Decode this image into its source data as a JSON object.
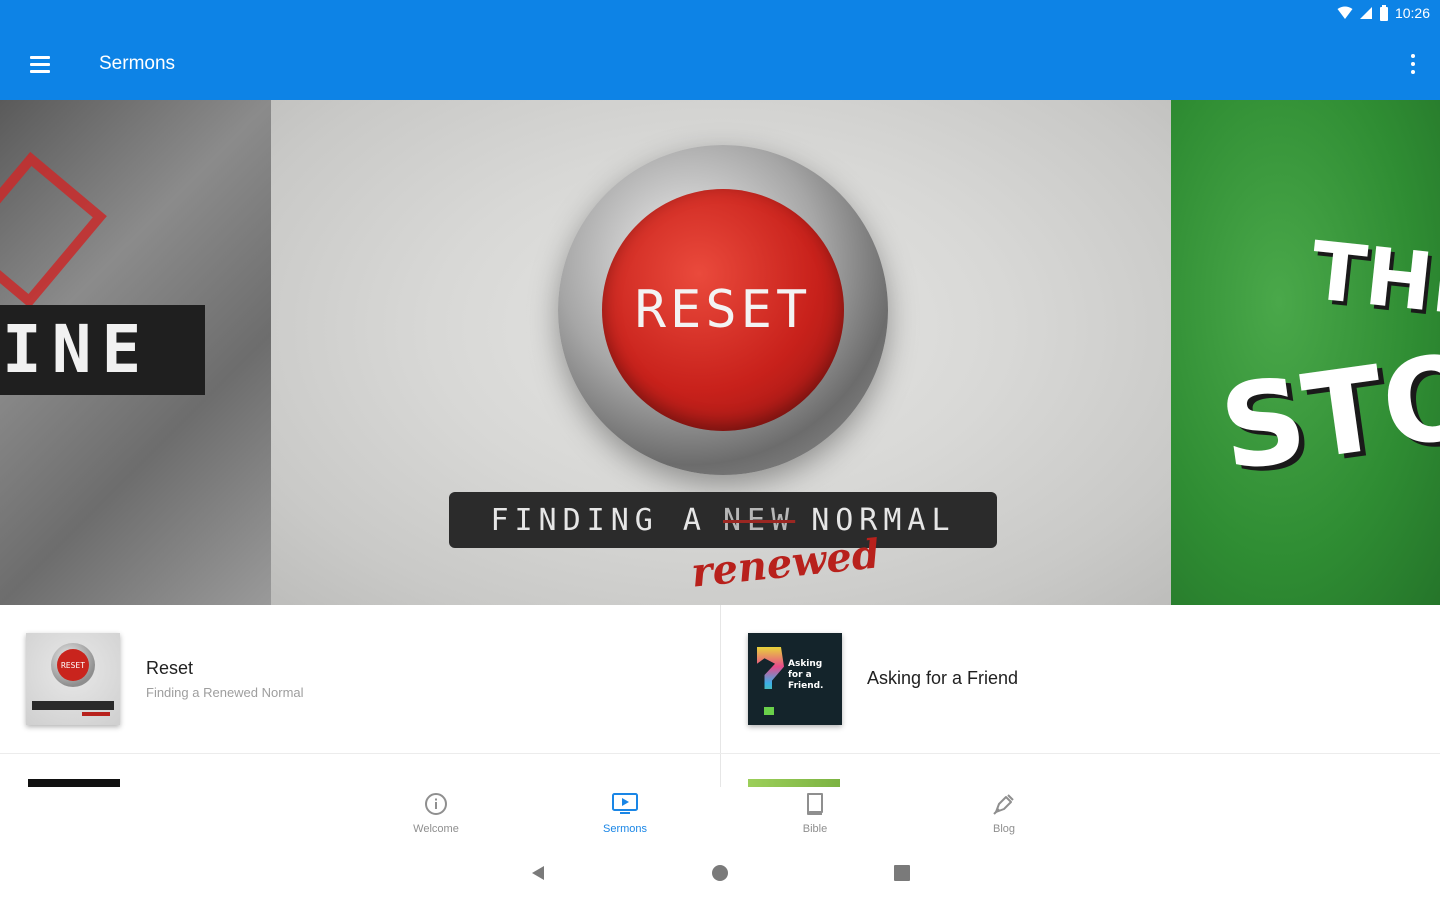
{
  "status_bar": {
    "time": "10:26"
  },
  "app_bar": {
    "title": "Sermons"
  },
  "carousel": {
    "left_slide": {
      "word": "INE"
    },
    "center_slide": {
      "button_text": "RESET",
      "tagline_start": "FINDING A",
      "tagline_struck": "NEW",
      "tagline_end": "NORMAL",
      "handwritten": "renewed"
    },
    "right_slide": {
      "line1": "THE",
      "line2": "STO"
    },
    "active_index": 0,
    "dot_count": 5
  },
  "sermons": [
    {
      "title": "Reset",
      "subtitle": "Finding a Renewed Normal",
      "thumb_text": "RESET"
    },
    {
      "title": "Asking for a Friend",
      "subtitle": "",
      "thumb_text": "Asking for a Friend."
    }
  ],
  "bottom_nav": {
    "items": [
      {
        "label": "Welcome",
        "icon": "info-icon"
      },
      {
        "label": "Sermons",
        "icon": "sermons-icon"
      },
      {
        "label": "Bible",
        "icon": "bible-icon"
      },
      {
        "label": "Blog",
        "icon": "blog-icon"
      }
    ],
    "active": "Sermons"
  },
  "colors": {
    "primary": "#0d83e6",
    "active_nav": "#1a86e6",
    "inactive_nav": "#8f8f8f"
  }
}
